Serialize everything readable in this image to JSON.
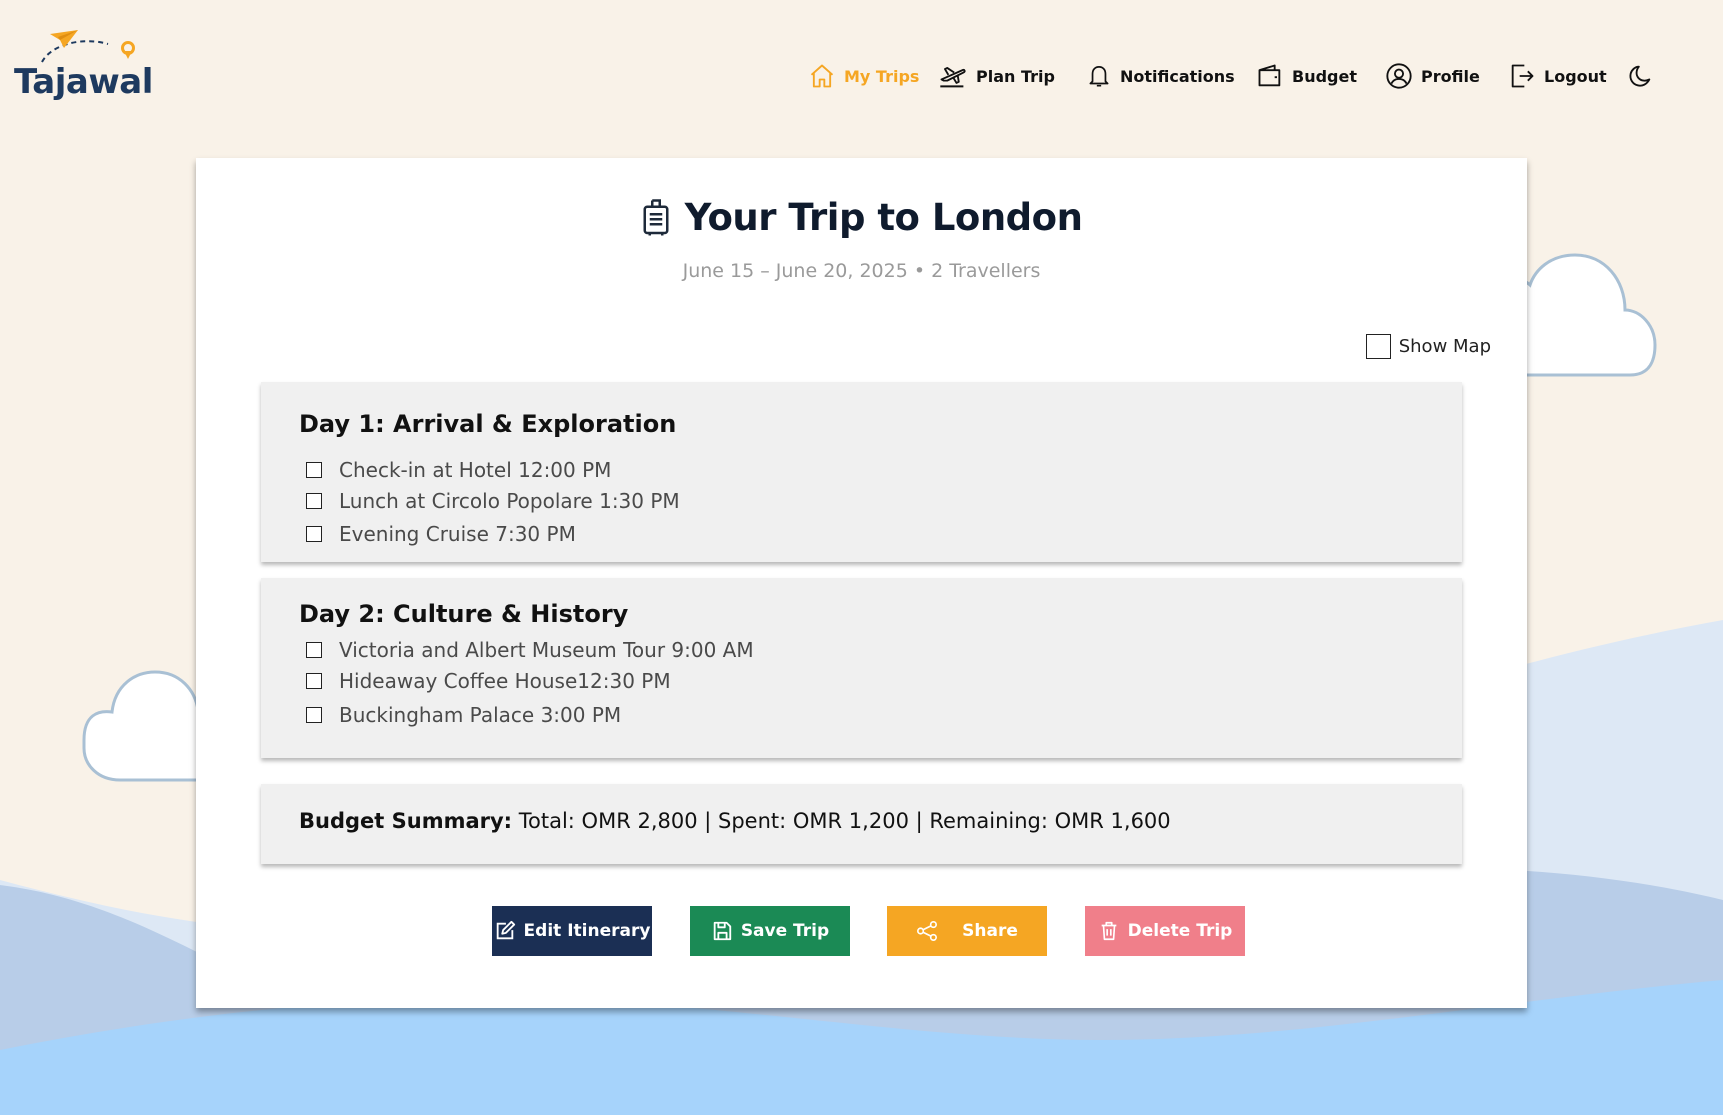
{
  "brand": {
    "name": "Tajawal",
    "colors": {
      "navy": "#1e3a5f",
      "orange": "#f5a623"
    }
  },
  "nav": {
    "items": [
      {
        "label": "My Trips",
        "icon": "home-icon",
        "active": true
      },
      {
        "label": "Plan Trip",
        "icon": "plane-takeoff-icon"
      },
      {
        "label": "Notifications",
        "icon": "bell-icon"
      },
      {
        "label": "Budget",
        "icon": "wallet-icon"
      },
      {
        "label": "Profile",
        "icon": "user-circle-icon"
      },
      {
        "label": "Logout",
        "icon": "logout-icon"
      }
    ],
    "theme_toggle_icon": "moon-icon"
  },
  "trip": {
    "title": "Your Trip to London",
    "title_icon": "luggage-icon",
    "subtitle": "June 15 – June 20, 2025 • 2 Travellers",
    "show_map_label": "Show Map",
    "days": [
      {
        "title": "Day 1: Arrival & Exploration",
        "activities": [
          "Check-in at Hotel 12:00 PM",
          "Lunch at Circolo Popolare 1:30 PM",
          "Evening Cruise 7:30 PM"
        ]
      },
      {
        "title": "Day 2: Culture & History",
        "activities": [
          "Victoria and Albert Museum Tour 9:00 AM",
          "Hideaway Coffee House12:30 PM",
          "Buckingham Palace 3:00 PM"
        ]
      }
    ],
    "budget": {
      "label": "Budget Summary:",
      "text": "Total: OMR 2,800 | Spent: OMR 1,200 | Remaining: OMR 1,600"
    }
  },
  "actions": {
    "edit": "Edit Itinerary",
    "save": "Save Trip",
    "share": "Share",
    "delete": "Delete Trip"
  }
}
